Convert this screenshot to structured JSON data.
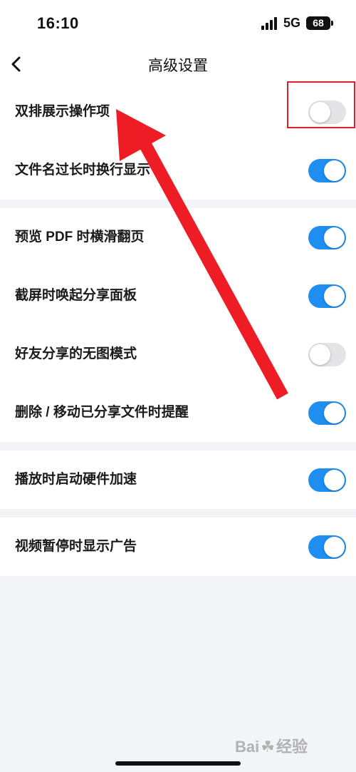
{
  "status_bar": {
    "time": "16:10",
    "network": "5G",
    "battery": "68"
  },
  "nav": {
    "back_icon": "chevron-left-icon",
    "title": "高级设置"
  },
  "groups": [
    {
      "items": [
        {
          "label": "双排展示操作项",
          "enabled": false
        },
        {
          "label": "文件名过长时换行显示",
          "enabled": true
        }
      ]
    },
    {
      "items": [
        {
          "label": "预览 PDF 时横滑翻页",
          "enabled": true
        },
        {
          "label": "截屏时唤起分享面板",
          "enabled": true
        },
        {
          "label": "好友分享的无图模式",
          "enabled": false
        },
        {
          "label": "删除 / 移动已分享文件时提醒",
          "enabled": true
        }
      ]
    },
    {
      "items": [
        {
          "label": "播放时启动硬件加速",
          "enabled": true
        }
      ]
    },
    {
      "items": [
        {
          "label": "视频暂停时显示广告",
          "enabled": true
        }
      ]
    }
  ],
  "annotation": {
    "highlight_color": "#e0202a",
    "arrow_color": "#ee1c24"
  },
  "watermark": {
    "text_left": "Bai",
    "text_right": "经验"
  },
  "colors": {
    "toggle_on": "#1f8ef1",
    "toggle_off": "#e4e4e6",
    "background": "#f3f4f8"
  }
}
